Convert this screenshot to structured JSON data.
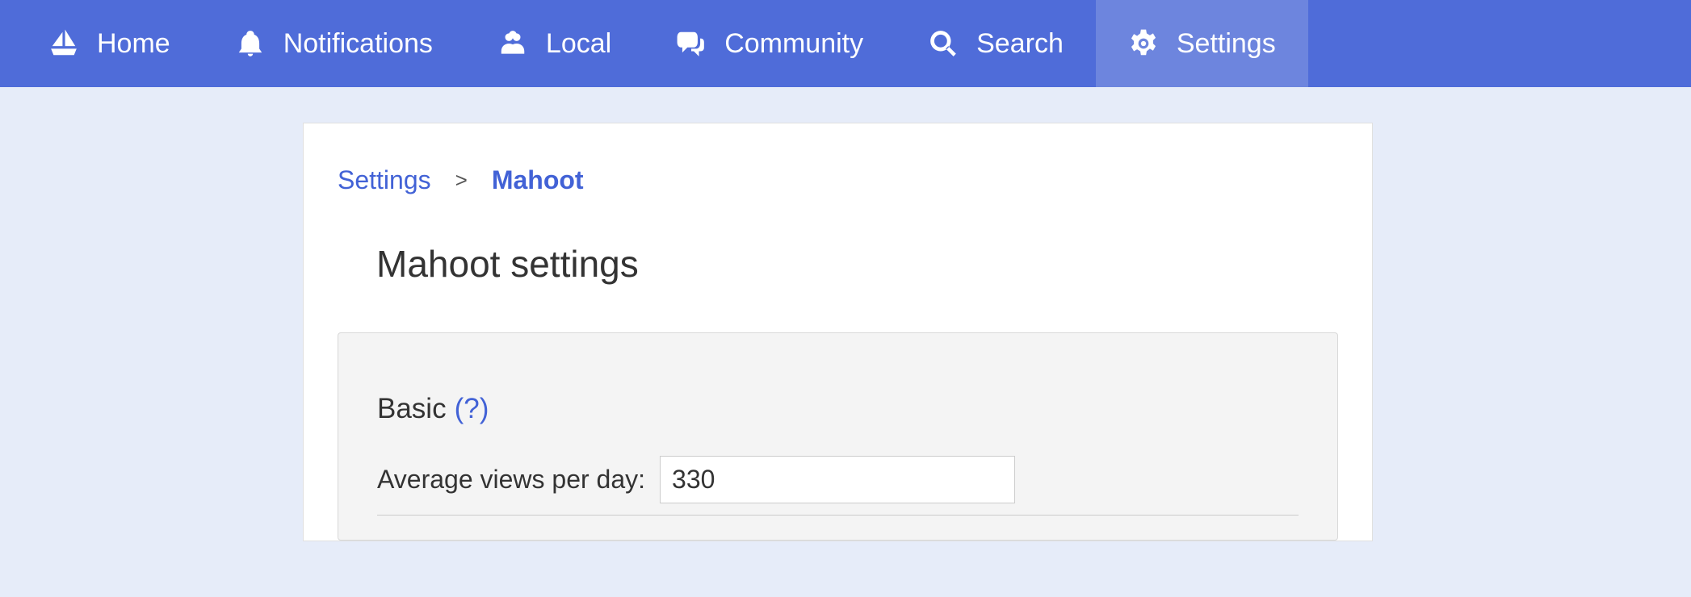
{
  "nav": {
    "home": "Home",
    "notifications": "Notifications",
    "local": "Local",
    "community": "Community",
    "search": "Search",
    "settings": "Settings"
  },
  "breadcrumb": {
    "root": "Settings",
    "sep": ">",
    "current": "Mahoot"
  },
  "page": {
    "title": "Mahoot settings"
  },
  "section": {
    "heading": "Basic",
    "help": "(?)"
  },
  "field": {
    "label": "Average views per day:",
    "value": "330"
  }
}
